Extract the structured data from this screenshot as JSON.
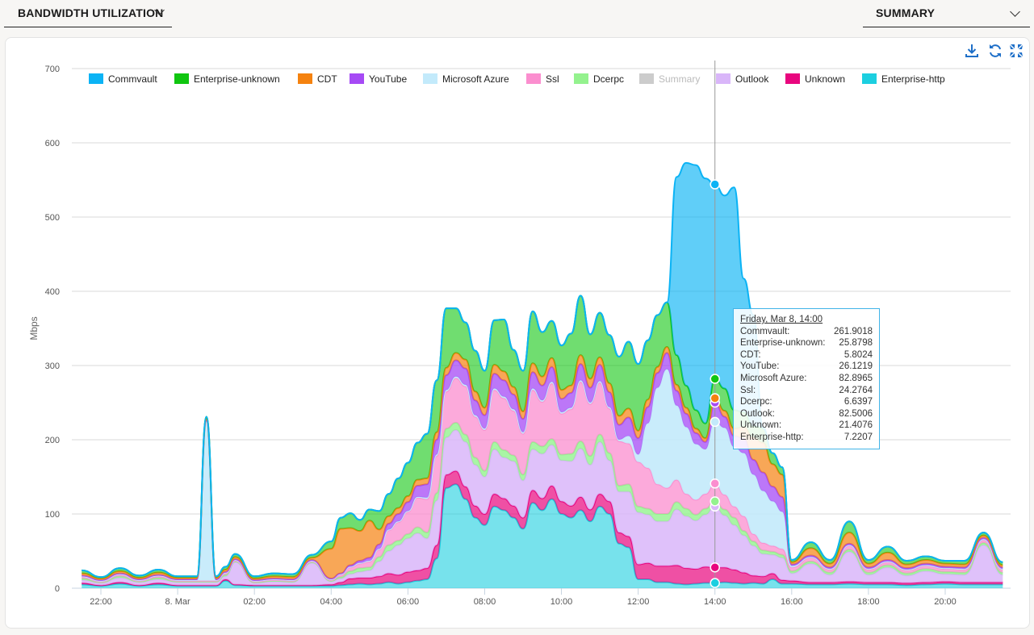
{
  "header": {
    "left_select": {
      "label": "BANDWIDTH UTILIZATION"
    },
    "right_select": {
      "label": "SUMMARY"
    }
  },
  "toolbar": {
    "icons": [
      "download-icon",
      "refresh-icon",
      "collapse-icon"
    ]
  },
  "tooltip": {
    "title": "Friday, Mar 8, 14:00",
    "rows": [
      {
        "label": "Commvault:",
        "value": "261.9018"
      },
      {
        "label": "Enterprise-unknown:",
        "value": "25.8798"
      },
      {
        "label": "CDT:",
        "value": "5.8024"
      },
      {
        "label": "YouTube:",
        "value": "26.1219"
      },
      {
        "label": "Microsoft Azure:",
        "value": "82.8965"
      },
      {
        "label": "Ssl:",
        "value": "24.2764"
      },
      {
        "label": "Dcerpc:",
        "value": "6.6397"
      },
      {
        "label": "Outlook:",
        "value": "82.5006"
      },
      {
        "label": "Unknown:",
        "value": "21.4076"
      },
      {
        "label": "Enterprise-http:",
        "value": "7.2207"
      }
    ]
  },
  "chart_data": {
    "type": "area",
    "stacked": true,
    "title": "",
    "xlabel": "",
    "ylabel": "Mbps",
    "ylim": [
      0,
      700
    ],
    "yticks": [
      0,
      100,
      200,
      300,
      400,
      500,
      600,
      700
    ],
    "xlim_hours": [
      -2.6,
      21.5
    ],
    "xticks": [
      {
        "hour": -2,
        "label": "22:00"
      },
      {
        "hour": 0,
        "label": "8. Mar"
      },
      {
        "hour": 2,
        "label": "02:00"
      },
      {
        "hour": 4,
        "label": "04:00"
      },
      {
        "hour": 6,
        "label": "06:00"
      },
      {
        "hour": 8,
        "label": "08:00"
      },
      {
        "hour": 10,
        "label": "10:00"
      },
      {
        "hour": 12,
        "label": "12:00"
      },
      {
        "hour": 14,
        "label": "14:00"
      },
      {
        "hour": 16,
        "label": "16:00"
      },
      {
        "hour": 18,
        "label": "18:00"
      },
      {
        "hour": 20,
        "label": "20:00"
      }
    ],
    "grid": true,
    "legend_position": "top",
    "crosshair_hour": 14,
    "legend": [
      {
        "name": "Commvault",
        "color": "#0bb3f5",
        "enabled": true
      },
      {
        "name": "Enterprise-unknown",
        "color": "#10c610",
        "enabled": true
      },
      {
        "name": "CDT",
        "color": "#f5820f",
        "enabled": true
      },
      {
        "name": "YouTube",
        "color": "#a64af5",
        "enabled": true
      },
      {
        "name": "Microsoft Azure",
        "color": "#c3eafb",
        "enabled": true
      },
      {
        "name": "Ssl",
        "color": "#fb8ecf",
        "enabled": true
      },
      {
        "name": "Dcerpc",
        "color": "#94f28e",
        "enabled": true
      },
      {
        "name": "Summary",
        "color": "#cccccc",
        "enabled": false
      },
      {
        "name": "Outlook",
        "color": "#d9b6f9",
        "enabled": true
      },
      {
        "name": "Unknown",
        "color": "#e8067e",
        "enabled": true
      },
      {
        "name": "Enterprise-http",
        "color": "#1ccfe0",
        "enabled": true
      }
    ],
    "x_hours": [
      -2.5,
      -2,
      -1.5,
      -1,
      -0.5,
      0,
      0.5,
      0.75,
      1,
      1.25,
      1.5,
      2,
      2.5,
      3,
      3.5,
      4,
      4.25,
      4.5,
      4.75,
      5,
      5.25,
      5.5,
      5.75,
      6,
      6.25,
      6.5,
      6.75,
      7,
      7.25,
      7.5,
      7.75,
      8,
      8.25,
      8.5,
      8.75,
      9,
      9.25,
      9.5,
      9.75,
      10,
      10.25,
      10.5,
      10.75,
      11,
      11.25,
      11.5,
      11.75,
      12,
      12.25,
      12.5,
      12.75,
      13,
      13.25,
      13.5,
      13.75,
      14,
      14.25,
      14.5,
      14.75,
      15,
      15.25,
      15.5,
      15.75,
      16,
      16.5,
      17,
      17.5,
      18,
      18.5,
      19,
      19.5,
      20,
      20.5,
      21,
      21.5
    ],
    "series": [
      {
        "name": "Enterprise-http",
        "values": [
          5,
          3,
          6,
          3,
          5,
          3,
          3,
          3,
          3,
          10,
          4,
          3,
          3,
          3,
          3,
          3,
          4,
          5,
          6,
          5,
          6,
          8,
          6,
          8,
          10,
          12,
          40,
          135,
          140,
          120,
          95,
          85,
          110,
          105,
          95,
          80,
          115,
          105,
          120,
          100,
          95,
          105,
          90,
          110,
          100,
          60,
          55,
          12,
          12,
          8,
          8,
          6,
          5,
          6,
          7,
          7,
          8,
          7,
          6,
          7,
          6,
          12,
          6,
          6,
          5,
          5,
          6,
          5,
          5,
          4,
          5,
          6,
          5,
          5,
          5
        ]
      },
      {
        "name": "Unknown",
        "values": [
          2,
          1,
          2,
          1,
          2,
          1,
          1,
          1,
          1,
          2,
          1,
          1,
          1,
          1,
          1,
          2,
          4,
          8,
          8,
          9,
          10,
          12,
          12,
          14,
          14,
          15,
          18,
          18,
          18,
          17,
          16,
          15,
          17,
          16,
          16,
          15,
          17,
          16,
          18,
          17,
          16,
          18,
          16,
          17,
          17,
          15,
          15,
          20,
          22,
          22,
          22,
          25,
          22,
          20,
          22,
          21,
          20,
          18,
          15,
          10,
          10,
          8,
          5,
          4,
          3,
          3,
          3,
          3,
          3,
          3,
          3,
          3,
          3,
          3,
          3
        ]
      },
      {
        "name": "Outlook",
        "values": [
          4,
          3,
          6,
          4,
          5,
          4,
          4,
          4,
          4,
          4,
          30,
          3,
          5,
          4,
          30,
          4,
          5,
          6,
          8,
          10,
          20,
          30,
          40,
          45,
          50,
          40,
          60,
          50,
          55,
          60,
          55,
          50,
          60,
          55,
          60,
          50,
          55,
          60,
          55,
          55,
          60,
          65,
          60,
          70,
          55,
          55,
          60,
          70,
          65,
          60,
          60,
          75,
          70,
          65,
          70,
          82,
          70,
          60,
          50,
          40,
          30,
          25,
          30,
          10,
          25,
          10,
          40,
          10,
          20,
          10,
          15,
          10,
          10,
          50,
          10
        ]
      },
      {
        "name": "Dcerpc",
        "values": [
          2,
          1,
          2,
          1,
          2,
          1,
          1,
          1,
          1,
          2,
          1,
          1,
          1,
          1,
          1,
          1,
          2,
          4,
          5,
          4,
          6,
          8,
          6,
          6,
          8,
          8,
          10,
          12,
          10,
          10,
          10,
          8,
          10,
          10,
          8,
          8,
          10,
          10,
          8,
          8,
          10,
          10,
          12,
          10,
          10,
          8,
          10,
          8,
          8,
          10,
          10,
          10,
          10,
          8,
          8,
          7,
          8,
          10,
          6,
          6,
          5,
          4,
          4,
          3,
          3,
          3,
          3,
          3,
          3,
          3,
          3,
          3,
          3,
          3,
          3
        ]
      },
      {
        "name": "Ssl",
        "values": [
          2,
          1,
          2,
          1,
          2,
          1,
          1,
          1,
          1,
          2,
          1,
          1,
          1,
          1,
          1,
          1,
          3,
          5,
          6,
          8,
          10,
          20,
          25,
          30,
          40,
          45,
          50,
          50,
          60,
          65,
          55,
          55,
          70,
          70,
          60,
          55,
          70,
          60,
          75,
          55,
          60,
          80,
          70,
          70,
          60,
          60,
          55,
          60,
          55,
          40,
          35,
          30,
          20,
          20,
          20,
          24,
          20,
          15,
          20,
          10,
          10,
          8,
          8,
          5,
          5,
          4,
          5,
          4,
          4,
          4,
          4,
          4,
          4,
          4,
          4
        ]
      },
      {
        "name": "Microsoft Azure",
        "values": [
          1,
          1,
          1,
          1,
          1,
          1,
          1,
          215,
          1,
          1,
          1,
          1,
          1,
          1,
          1,
          1,
          1,
          1,
          1,
          1,
          1,
          1,
          1,
          1,
          1,
          2,
          2,
          2,
          2,
          2,
          2,
          2,
          2,
          2,
          2,
          2,
          2,
          2,
          2,
          2,
          2,
          2,
          2,
          2,
          2,
          2,
          10,
          10,
          60,
          130,
          160,
          100,
          90,
          75,
          60,
          83,
          90,
          80,
          85,
          80,
          70,
          60,
          50,
          2,
          1,
          1,
          1,
          1,
          1,
          1,
          1,
          1,
          1,
          1,
          1
        ]
      },
      {
        "name": "YouTube",
        "values": [
          1,
          1,
          1,
          1,
          1,
          1,
          1,
          1,
          1,
          1,
          1,
          1,
          1,
          1,
          1,
          1,
          1,
          2,
          3,
          4,
          6,
          8,
          10,
          12,
          15,
          18,
          20,
          20,
          22,
          22,
          20,
          18,
          20,
          22,
          20,
          18,
          22,
          20,
          20,
          18,
          20,
          22,
          20,
          22,
          20,
          20,
          25,
          22,
          22,
          20,
          22,
          20,
          18,
          15,
          10,
          26,
          15,
          15,
          20,
          20,
          25,
          20,
          20,
          2,
          2,
          2,
          2,
          2,
          2,
          2,
          2,
          2,
          2,
          2,
          2
        ]
      },
      {
        "name": "CDT",
        "values": [
          3,
          2,
          3,
          2,
          3,
          2,
          2,
          2,
          2,
          3,
          3,
          2,
          3,
          3,
          3,
          40,
          60,
          50,
          40,
          50,
          20,
          10,
          8,
          8,
          8,
          8,
          10,
          10,
          10,
          12,
          12,
          10,
          12,
          12,
          10,
          10,
          12,
          12,
          12,
          12,
          10,
          12,
          12,
          10,
          12,
          12,
          12,
          10,
          10,
          8,
          8,
          8,
          8,
          6,
          5,
          6,
          8,
          10,
          15,
          30,
          40,
          30,
          30,
          3,
          10,
          5,
          15,
          5,
          10,
          5,
          5,
          4,
          4,
          3,
          3
        ]
      },
      {
        "name": "Enterprise-unknown",
        "values": [
          4,
          2,
          4,
          3,
          4,
          2,
          2,
          3,
          2,
          4,
          4,
          3,
          4,
          4,
          4,
          10,
          15,
          20,
          15,
          15,
          25,
          30,
          40,
          45,
          50,
          60,
          70,
          80,
          60,
          50,
          55,
          50,
          60,
          70,
          50,
          55,
          70,
          60,
          50,
          60,
          70,
          80,
          60,
          60,
          65,
          80,
          90,
          90,
          80,
          70,
          60,
          40,
          30,
          25,
          20,
          26,
          30,
          25,
          20,
          15,
          20,
          15,
          10,
          3,
          8,
          5,
          15,
          5,
          8,
          5,
          5,
          4,
          5,
          4,
          4
        ]
      },
      {
        "name": "Commvault",
        "values": [
          0,
          0,
          0,
          0,
          0,
          0,
          0,
          0,
          0,
          0,
          0,
          0,
          0,
          0,
          0,
          0,
          0,
          0,
          0,
          0,
          0,
          0,
          0,
          0,
          0,
          0,
          0,
          0,
          0,
          0,
          0,
          0,
          0,
          0,
          0,
          0,
          0,
          0,
          0,
          0,
          0,
          0,
          0,
          0,
          0,
          0,
          0,
          0,
          0,
          0,
          0,
          240,
          300,
          330,
          330,
          262,
          260,
          300,
          180,
          150,
          0,
          0,
          0,
          0,
          0,
          0,
          0,
          0,
          0,
          0,
          0,
          0,
          0,
          0,
          0
        ]
      }
    ],
    "tooltip_point": {
      "hour": 14
    }
  }
}
